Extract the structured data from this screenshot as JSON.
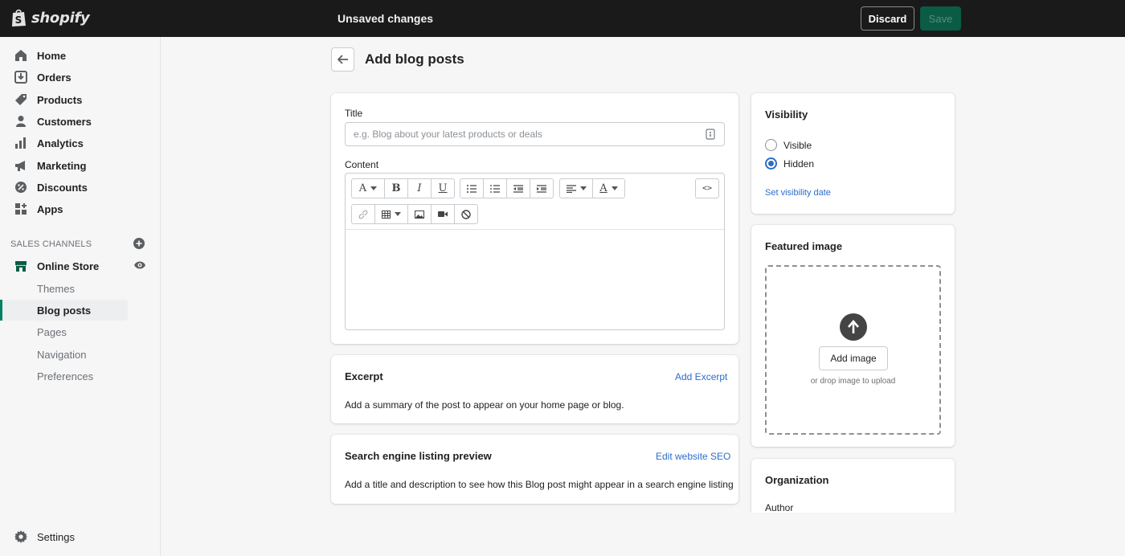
{
  "topbar": {
    "logo_text": "shopify",
    "status": "Unsaved changes",
    "discard_label": "Discard",
    "save_label": "Save"
  },
  "sidebar": {
    "items": [
      {
        "label": "Home",
        "icon": "home-icon"
      },
      {
        "label": "Orders",
        "icon": "orders-icon"
      },
      {
        "label": "Products",
        "icon": "tag-icon"
      },
      {
        "label": "Customers",
        "icon": "person-icon"
      },
      {
        "label": "Analytics",
        "icon": "bar-chart-icon"
      },
      {
        "label": "Marketing",
        "icon": "megaphone-icon"
      },
      {
        "label": "Discounts",
        "icon": "discount-icon"
      },
      {
        "label": "Apps",
        "icon": "apps-icon"
      }
    ],
    "channels_heading": "SALES CHANNELS",
    "online_store": "Online Store",
    "sub_items": [
      "Themes",
      "Blog posts",
      "Pages",
      "Navigation",
      "Preferences"
    ],
    "active_sub_item": "Blog posts",
    "settings": "Settings"
  },
  "page": {
    "title": "Add blog posts"
  },
  "post_card": {
    "title_label": "Title",
    "title_placeholder": "e.g. Blog about your latest products or deals",
    "content_label": "Content"
  },
  "excerpt": {
    "heading": "Excerpt",
    "action": "Add Excerpt",
    "description": "Add a summary of the post to appear on your home page or blog."
  },
  "seo": {
    "heading": "Search engine listing preview",
    "action": "Edit website SEO",
    "description": "Add a title and description to see how this Blog post might appear in a search engine listing"
  },
  "visibility": {
    "heading": "Visibility",
    "options": [
      "Visible",
      "Hidden"
    ],
    "selected": "Hidden",
    "date_link": "Set visibility date"
  },
  "featured_image": {
    "heading": "Featured image",
    "button": "Add image",
    "hint": "or drop image to upload"
  },
  "organization": {
    "heading": "Organization",
    "author_label": "Author"
  },
  "colors": {
    "topbar": "#1a1a1a",
    "save": "#0b5c45",
    "accent": "#008060",
    "link": "#2c6ecb"
  }
}
